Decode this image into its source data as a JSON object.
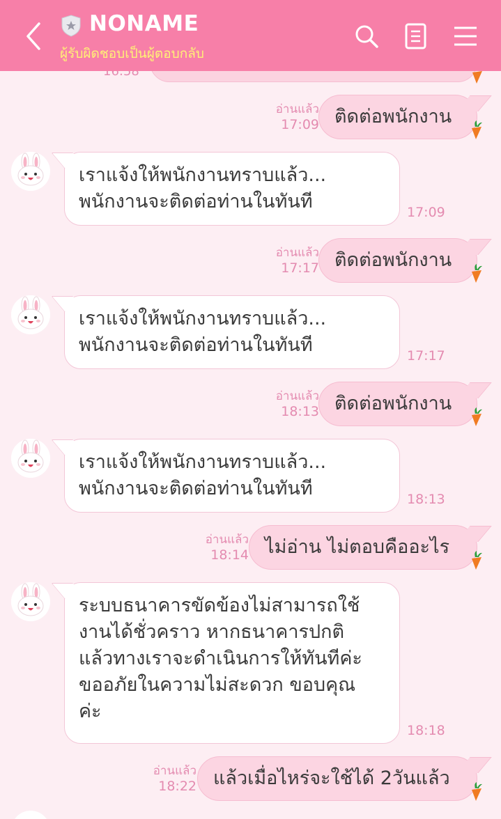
{
  "header": {
    "title": "NONAME",
    "subtitle": "ผู้รับผิดชอบเป็นผู้ตอบกลับ"
  },
  "peek": {
    "time": "16:58"
  },
  "messages": [
    {
      "dir": "out",
      "text": "ติดต่อพนักงาน",
      "read": "อ่านแล้ว",
      "time": "17:09"
    },
    {
      "dir": "in",
      "text": "เราแจ้งให้พนักงานทราบแล้ว...\nพนักงานจะติดต่อท่านในทันที",
      "time": "17:09"
    },
    {
      "dir": "out",
      "text": "ติดต่อพนักงาน",
      "read": "อ่านแล้ว",
      "time": "17:17"
    },
    {
      "dir": "in",
      "text": "เราแจ้งให้พนักงานทราบแล้ว...\nพนักงานจะติดต่อท่านในทันที",
      "time": "17:17"
    },
    {
      "dir": "out",
      "text": "ติดต่อพนักงาน",
      "read": "อ่านแล้ว",
      "time": "18:13"
    },
    {
      "dir": "in",
      "text": "เราแจ้งให้พนักงานทราบแล้ว...\nพนักงานจะติดต่อท่านในทันที",
      "time": "18:13"
    },
    {
      "dir": "out",
      "text": "ไม่อ่าน ไม่ตอบคืออะไร",
      "read": "อ่านแล้ว",
      "time": "18:14"
    },
    {
      "dir": "in",
      "text": "ระบบธนาคารขัดข้องไม่สามารถใช้\nงานได้ชั่วคราว  หากธนาคารปกติ\nแล้วทางเราจะดำเนินการให้ทันทีค่ะ\nขออภัยในความไม่สะดวก ขอบคุณ\nค่ะ",
      "time": "18:18"
    },
    {
      "dir": "out",
      "text": "แล้วเมื่อไหร่จะใช้ได้ 2วันแล้ว",
      "read": "อ่านแล้ว",
      "time": "18:22"
    }
  ],
  "colors": {
    "header_bg": "#f77fa8",
    "subtitle": "#fff176",
    "chat_bg": "#fdeef3",
    "bubble_out": "#fcd5e2",
    "bubble_in": "#ffffff",
    "timestamp": "#e48bb0"
  },
  "icons": [
    "back-arrow-icon",
    "shield-star-icon",
    "search-icon",
    "notes-icon",
    "menu-icon",
    "carrot-sticker-icon",
    "bunny-avatar-icon"
  ]
}
